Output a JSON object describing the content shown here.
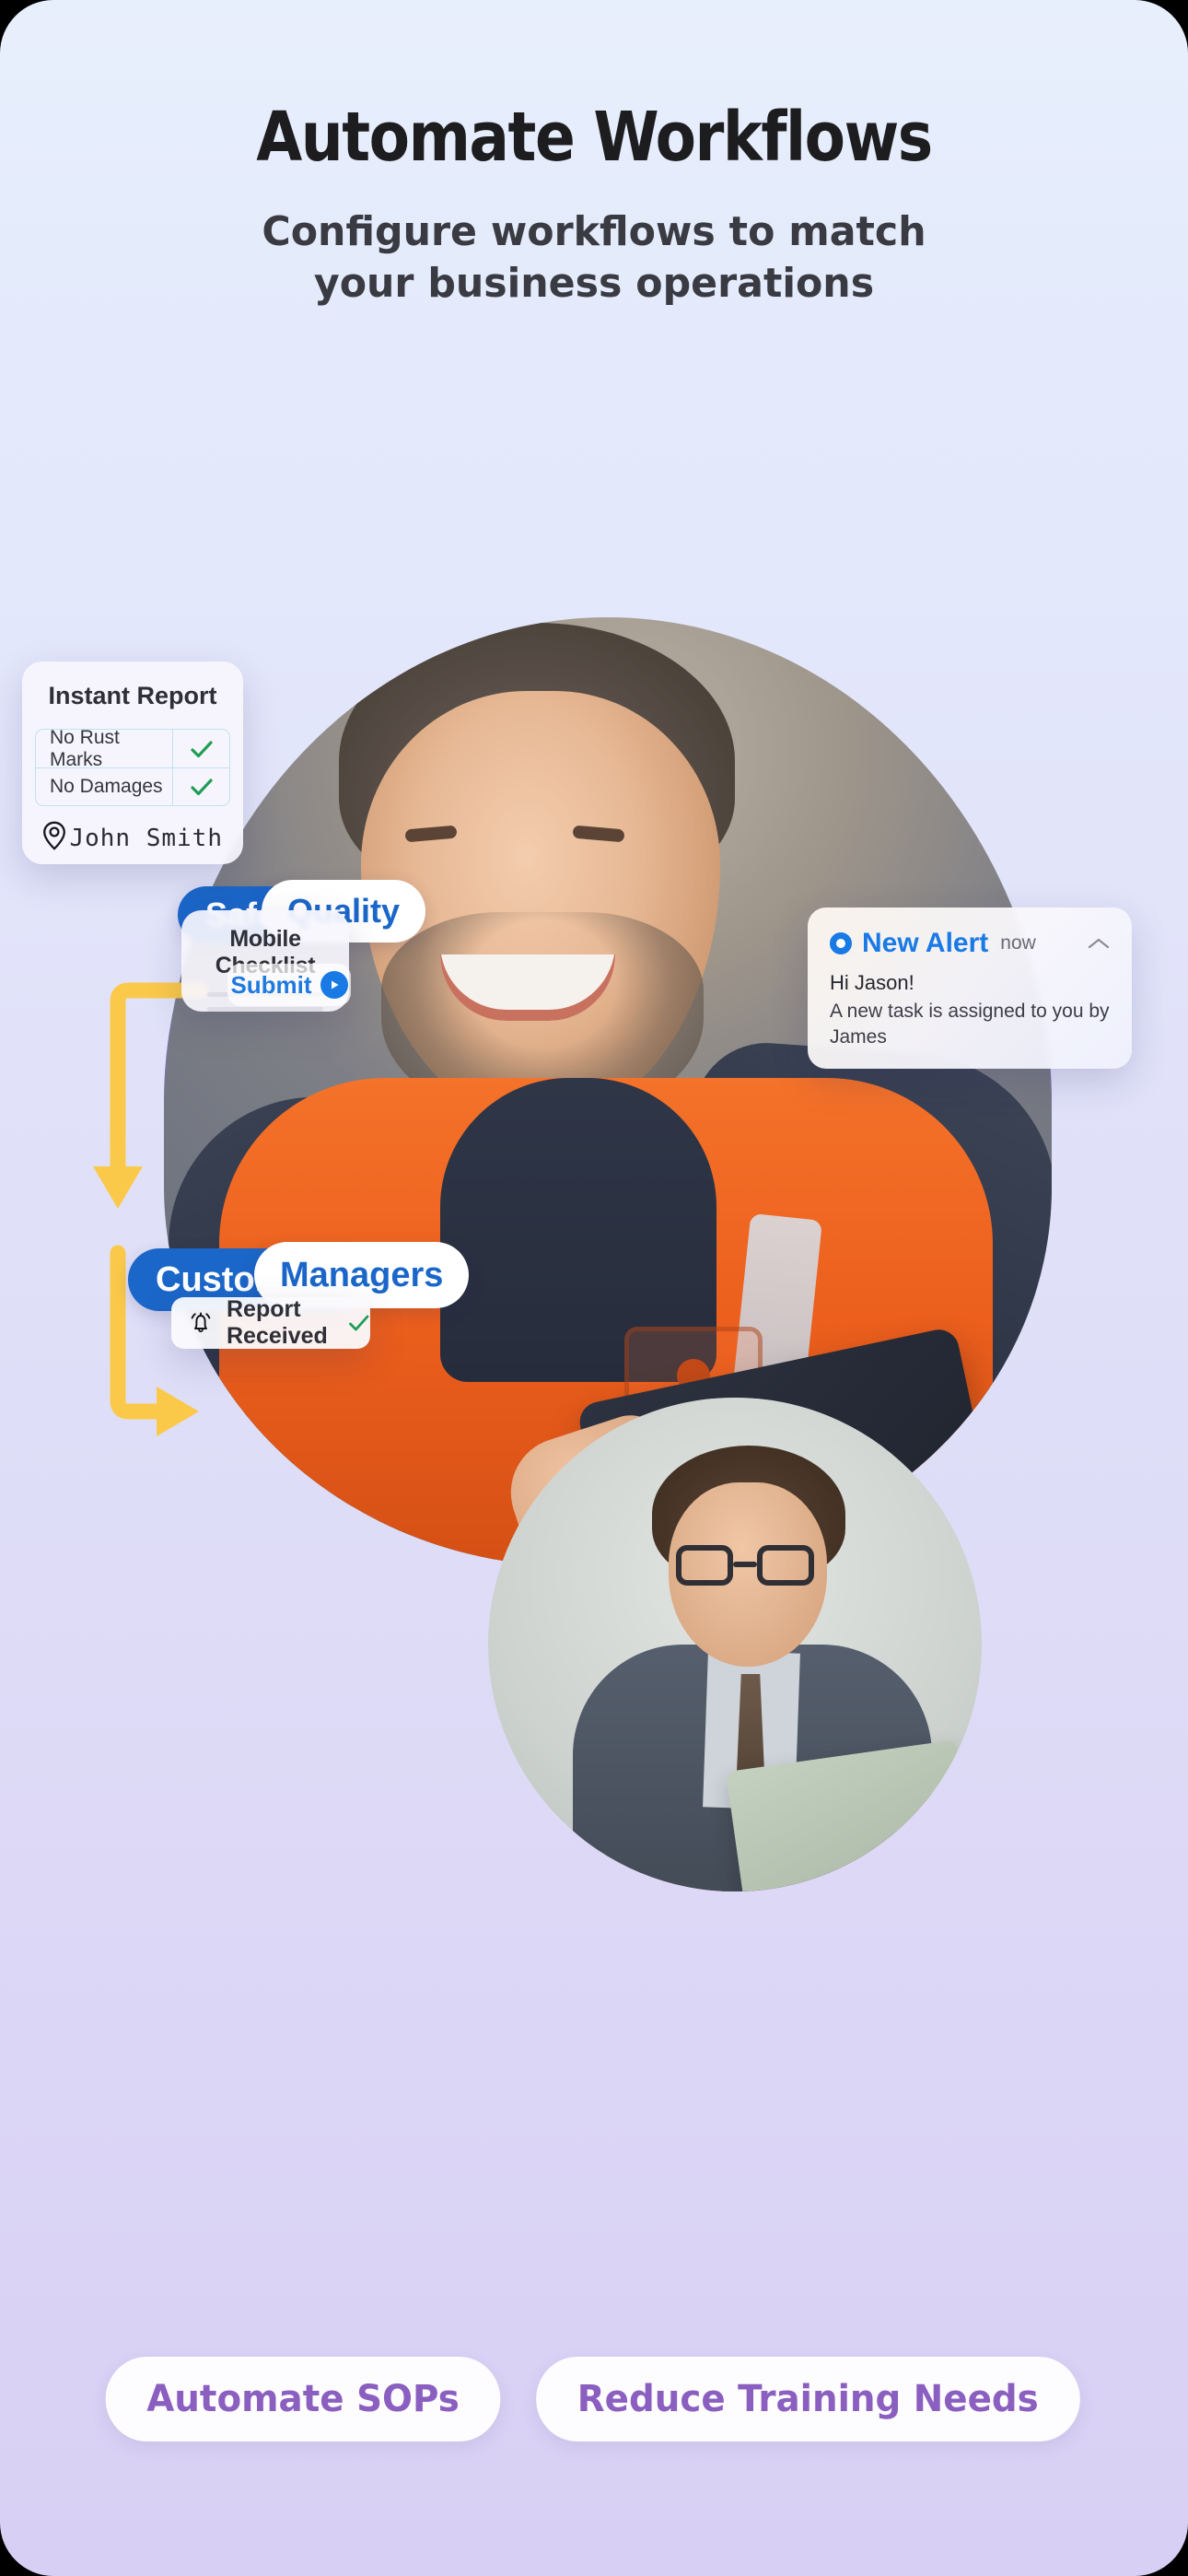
{
  "header": {
    "title": "Automate Workflows",
    "subtitle_line1": "Configure workflows to match",
    "subtitle_line2": "your business operations"
  },
  "hero": {
    "audience_pills_top": [
      {
        "label": "Safety",
        "style": "filled"
      },
      {
        "label": "Quality",
        "style": "outline"
      }
    ],
    "audience_pills_bottom": [
      {
        "label": "Customers",
        "style": "filled"
      },
      {
        "label": "Managers",
        "style": "outline"
      }
    ],
    "checklist_card": {
      "title": "Mobile Checklist",
      "submit_label": "Submit",
      "submit_icon": "play-circle-icon"
    },
    "report_card": {
      "title": "Instant Report",
      "rows": [
        {
          "label": "No Rust Marks",
          "checked": true
        },
        {
          "label": "No Damages",
          "checked": true
        }
      ],
      "location_icon": "map-pin-icon",
      "signature": "John  Smith"
    },
    "alert_card": {
      "status_icon": "record-dot-icon",
      "title": "New Alert",
      "time": "now",
      "collapse_icon": "chevron-up-icon",
      "greeting": "Hi Jason!",
      "message": "A new task is assigned to you by James"
    },
    "received_card": {
      "icon": "bell-ringing-icon",
      "label": "Report Received",
      "status_icon": "check-icon"
    }
  },
  "footer": {
    "ctas": [
      {
        "label": "Automate SOPs"
      },
      {
        "label": "Reduce Training Needs"
      }
    ]
  },
  "colors": {
    "accent_blue": "#1b67c9",
    "link_blue": "#1a7ae5",
    "purple_disc": "#8467f2",
    "flow_yellow": "#fbc94a",
    "cta_purple": "#8b5fbf",
    "check_green": "#1f9d55",
    "bg_top": "#e8effc",
    "bg_bottom": "#d8d0f4"
  }
}
